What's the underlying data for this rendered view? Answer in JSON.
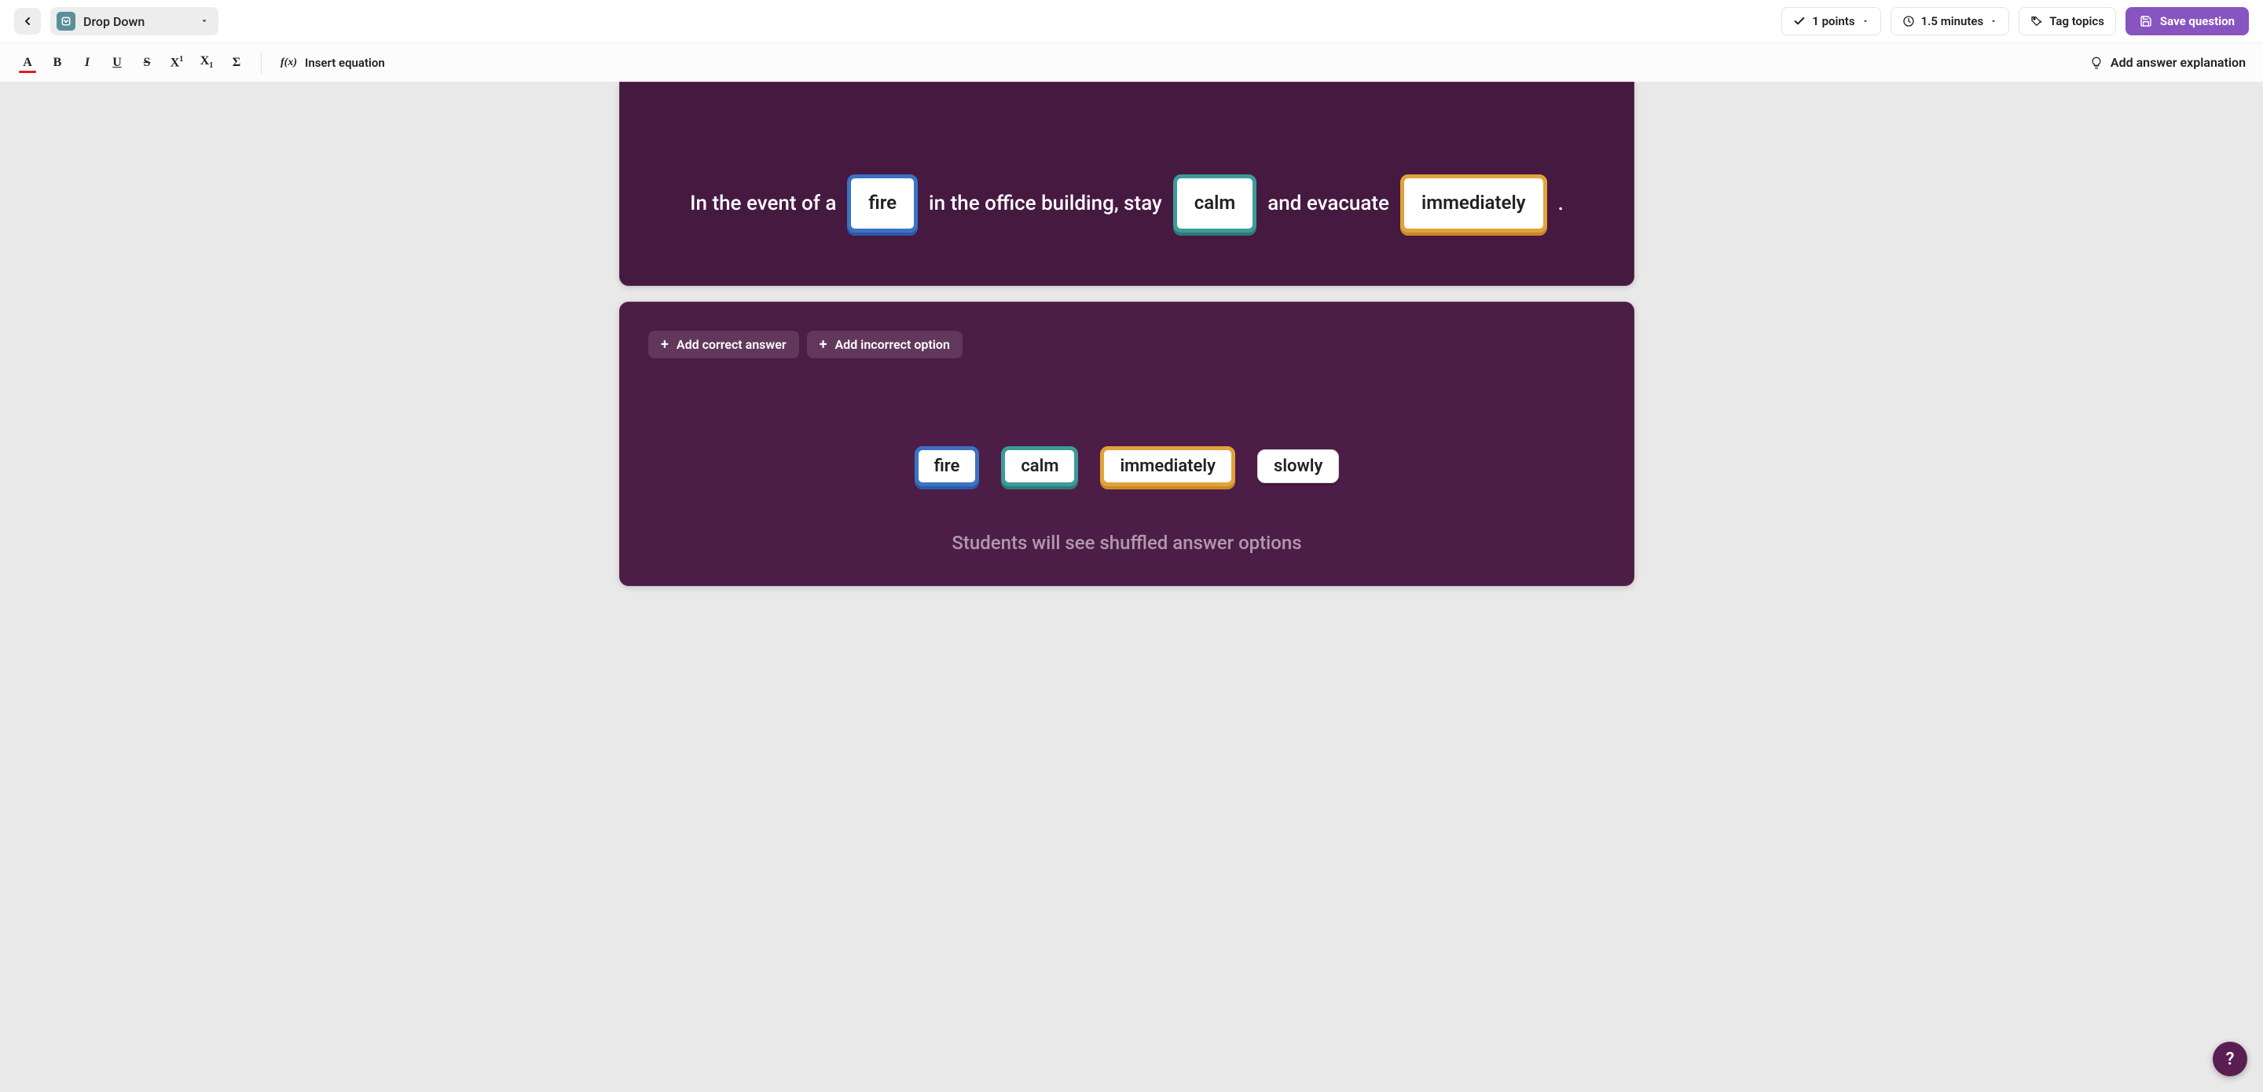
{
  "topbar": {
    "question_type": "Drop Down",
    "points_label": "1 points",
    "time_label": "1.5 minutes",
    "tag_label": "Tag topics",
    "save_label": "Save question"
  },
  "fmtbar": {
    "insert_equation_label": "Insert equation",
    "add_explanation_label": "Add answer explanation"
  },
  "question": {
    "segments": [
      {
        "type": "text",
        "value": "In the event of a"
      },
      {
        "type": "blank",
        "value": "fire",
        "color": "blue"
      },
      {
        "type": "text",
        "value": "in the office building, stay"
      },
      {
        "type": "blank",
        "value": "calm",
        "color": "teal"
      },
      {
        "type": "text",
        "value": "and evacuate"
      },
      {
        "type": "blank",
        "value": "immediately",
        "color": "orange"
      },
      {
        "type": "text",
        "value": "."
      }
    ]
  },
  "answers": {
    "add_correct_label": "Add correct answer",
    "add_incorrect_label": "Add incorrect option",
    "options": [
      {
        "label": "fire",
        "color": "blue"
      },
      {
        "label": "calm",
        "color": "teal"
      },
      {
        "label": "immediately",
        "color": "orange"
      },
      {
        "label": "slowly",
        "color": "none"
      }
    ],
    "shuffle_note": "Students will see shuffled answer options"
  },
  "help_label": "?"
}
